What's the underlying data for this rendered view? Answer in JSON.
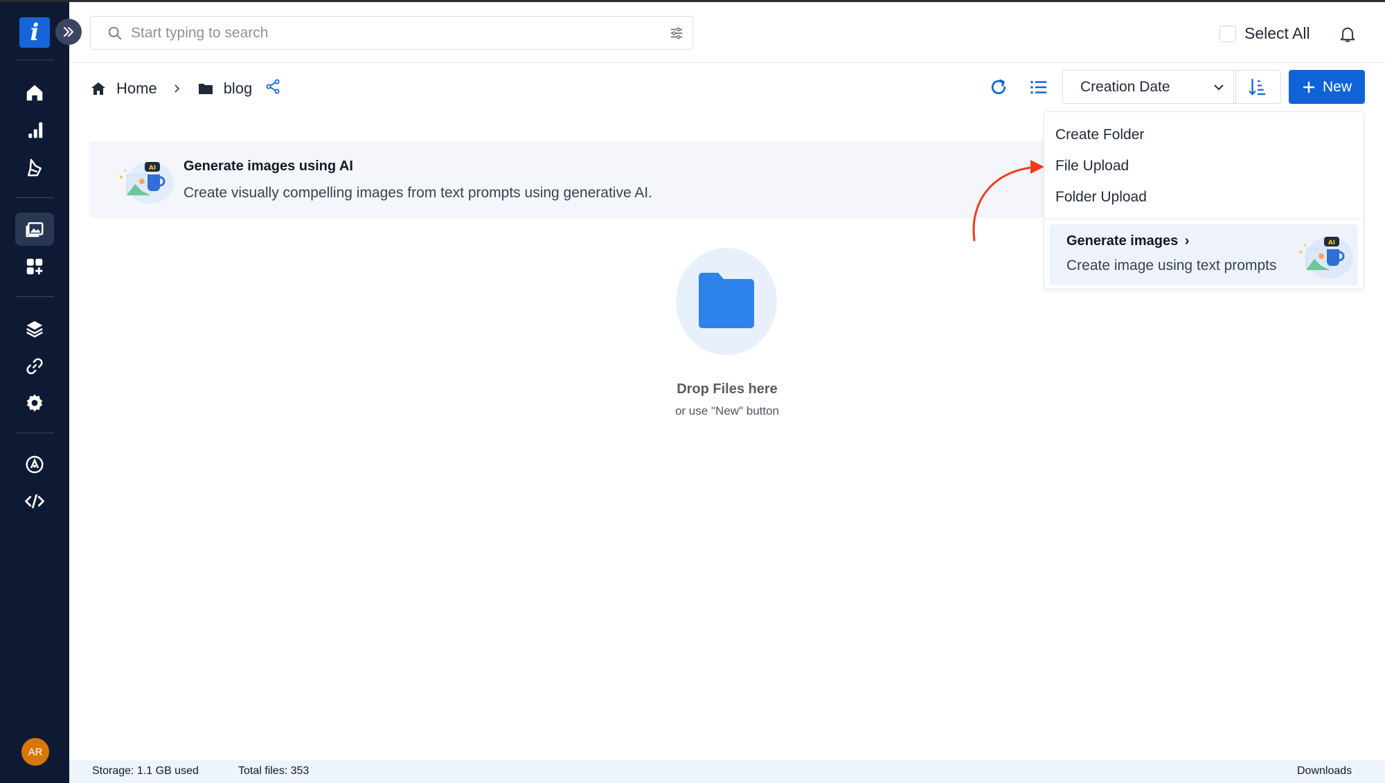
{
  "search": {
    "placeholder": "Start typing to search"
  },
  "header": {
    "select_all_label": "Select All"
  },
  "sidebar": {
    "logo_letter": "i",
    "user_initials": "AR",
    "items": [
      "home-icon",
      "analytics-icon",
      "cleanup-icon",
      "media-library-icon",
      "apps-icon",
      "layers-icon",
      "link-icon",
      "settings-icon",
      "developer-icon",
      "code-icon"
    ]
  },
  "breadcrumb": {
    "home": "Home",
    "folder": "blog"
  },
  "toolbar": {
    "sort_by": "Creation Date",
    "new_label": "New"
  },
  "banner": {
    "title": "Generate images using AI",
    "description": "Create visually compelling images from text prompts using generative AI."
  },
  "new_menu": {
    "items": [
      "Create Folder",
      "File Upload",
      "Folder Upload"
    ],
    "generate_title": "Generate images",
    "generate_chevron": "›",
    "generate_description": "Create image using text prompts"
  },
  "empty_state": {
    "title": "Drop Files here",
    "subtitle": "or use \"New\" button"
  },
  "footer": {
    "storage": "Storage: 1.1 GB used",
    "total_files": "Total files: 353",
    "downloads": "Downloads"
  },
  "colors": {
    "sidebar_bg": "#0e1a33",
    "primary": "#1063d6",
    "annotation_arrow": "#ef3b1c",
    "folder": "#2d83ea"
  }
}
